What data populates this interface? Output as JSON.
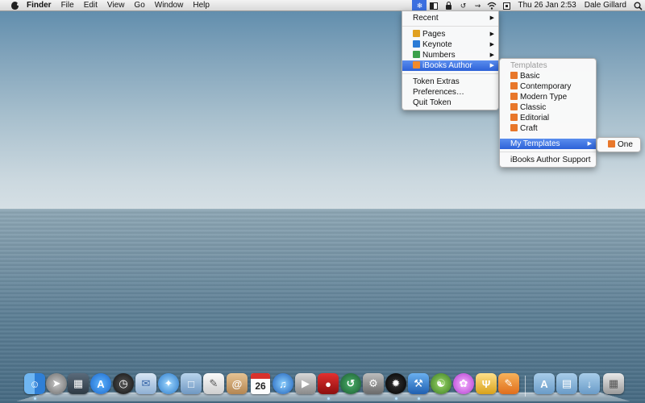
{
  "menubar": {
    "app_name": "Finder",
    "menus": [
      "File",
      "Edit",
      "View",
      "Go",
      "Window",
      "Help"
    ],
    "status_icons": [
      "token-icon",
      "display-icon",
      "lock-icon",
      "time-machine-icon",
      "bluetooth-icon",
      "wifi-icon",
      "input-icon"
    ],
    "clock": "Thu 26 Jan  2:53",
    "user": "Dale Gillard",
    "spotlight_icon": "magnifier-icon"
  },
  "token_menu": {
    "recent": "Recent",
    "apps": [
      "Pages",
      "Keynote",
      "Numbers",
      "iBooks Author"
    ],
    "extras": "Token Extras",
    "preferences": "Preferences…",
    "quit": "Quit Token",
    "highlighted": "iBooks Author"
  },
  "ibooks_submenu": {
    "header": "Templates",
    "templates": [
      "Basic",
      "Contemporary",
      "Modern Type",
      "Classic",
      "Editorial",
      "Craft"
    ],
    "my_templates": "My Templates",
    "support": "iBooks Author Support"
  },
  "my_templates_submenu": {
    "items": [
      "One"
    ]
  },
  "dock": {
    "calendar_day": "26",
    "apps": [
      "Finder",
      "Launchpad",
      "Mission Control",
      "App Store",
      "Dashboard",
      "Mail",
      "Safari",
      "Preview",
      "TextEdit",
      "Contacts",
      "Calendar",
      "iTunes",
      "FaceTime",
      "Photo Booth",
      "Time Machine",
      "System Preferences",
      "Aperture",
      "Xcode",
      "Coda",
      "Flower",
      "Lyre",
      "Pages",
      "Applications",
      "Documents",
      "Downloads",
      "Trash"
    ]
  },
  "colors": {
    "highlight": "#2d62d8",
    "token_icon": "#3b6fe0",
    "menu_bg": "#fafafa"
  }
}
